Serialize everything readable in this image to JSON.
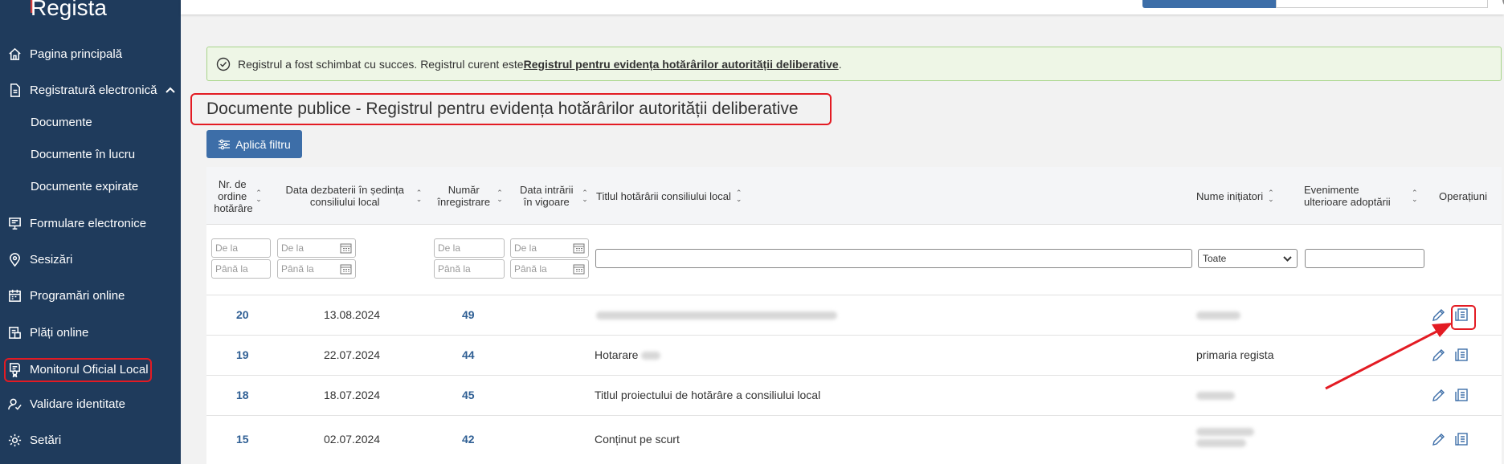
{
  "app": {
    "logo": "Regista"
  },
  "sidebar": {
    "items": [
      {
        "label": "Pagina principală",
        "icon": "home-icon"
      },
      {
        "label": "Registratură electronică",
        "icon": "document-icon"
      },
      {
        "label": "Formulare electronice",
        "icon": "monitor-form-icon"
      },
      {
        "label": "Sesizări",
        "icon": "location-pin-icon"
      },
      {
        "label": "Programări online",
        "icon": "calendar-icon"
      },
      {
        "label": "Plăți online",
        "icon": "payment-icon"
      },
      {
        "label": "Monitorul Oficial Local",
        "icon": "certificate-icon"
      },
      {
        "label": "Validare identitate",
        "icon": "user-check-icon"
      },
      {
        "label": "Setări",
        "icon": "gear-icon"
      }
    ],
    "sub_items": [
      {
        "label": "Documente"
      },
      {
        "label": "Documente în lucru"
      },
      {
        "label": "Documente expirate"
      }
    ]
  },
  "alert": {
    "text": "Registrul a fost schimbat cu succes. Registrul curent este ",
    "link": "Registrul pentru evidența hotărârilor autorității deliberative",
    "suffix": "."
  },
  "page": {
    "title": "Documente publice - Registrul pentru evidența hotărârilor autorității deliberative",
    "filter_button": "Aplică filtru"
  },
  "table": {
    "headers": {
      "nr_ordine": "Nr. de ordine hotărâre",
      "data_dezbaterii": "Data dezbaterii în ședința consiliului local",
      "numar_inregistrare": "Număr înregistrare",
      "data_intrarii": "Data intrării în vigoare",
      "titlul": "Titlul hotărârii consiliului local",
      "initiatori": "Nume inițiatori",
      "evenimente": "Evenimente ulterioare adoptării",
      "operatiuni": "Operațiuni"
    },
    "filters": {
      "from_placeholder": "De la",
      "to_placeholder": "Până la",
      "initiatori_select": "Toate"
    },
    "rows": [
      {
        "nr": "20",
        "data": "13.08.2024",
        "numar": "49",
        "titlu": "",
        "initiator": ""
      },
      {
        "nr": "19",
        "data": "22.07.2024",
        "numar": "44",
        "titlu": "Hotarare",
        "initiator": "primaria regista"
      },
      {
        "nr": "18",
        "data": "18.07.2024",
        "numar": "45",
        "titlu": "Titlul proiectului de hotărâre a consiliului local",
        "initiator": ""
      },
      {
        "nr": "15",
        "data": "02.07.2024",
        "numar": "42",
        "titlu": "Conținut pe scurt",
        "initiator": ""
      }
    ]
  },
  "colors": {
    "sidebar_bg": "#1f3b5c",
    "accent": "#3d6ea8",
    "highlight": "#e31b23",
    "success_bg": "#eef6e6"
  }
}
